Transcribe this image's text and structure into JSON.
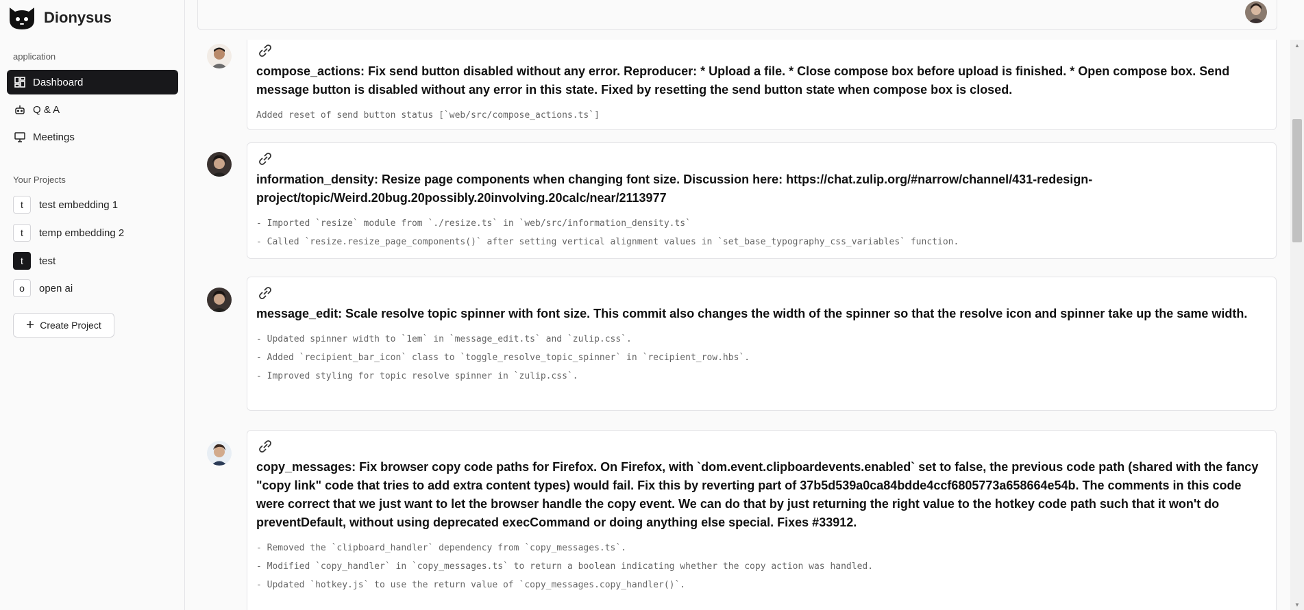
{
  "app": {
    "name": "Dionysus"
  },
  "sidebar": {
    "section_application": "application",
    "nav": [
      {
        "label": "Dashboard",
        "icon": "dashboard-icon",
        "active": true
      },
      {
        "label": "Q & A",
        "icon": "bot-icon",
        "active": false
      },
      {
        "label": "Meetings",
        "icon": "presentation-icon",
        "active": false
      }
    ],
    "section_projects": "Your Projects",
    "projects": [
      {
        "badge": "t",
        "label": "test embedding 1",
        "selected": false
      },
      {
        "badge": "t",
        "label": "temp embedding 2",
        "selected": false
      },
      {
        "badge": "t",
        "label": "test",
        "selected": true
      },
      {
        "badge": "o",
        "label": "open ai",
        "selected": false
      }
    ],
    "create_project_label": "Create Project"
  },
  "colors": {
    "active_nav_bg": "#18181b",
    "card_border": "#e4e4e7"
  },
  "commits": [
    {
      "title": "compose_actions: Fix send button disabled without any error. Reproducer: * Upload a file. * Close compose box before upload is finished. * Open compose box. Send message button is disabled without any error in this state. Fixed by resetting the send button state when compose box is closed.",
      "notes": [
        "Added reset of send button status [`web/src/compose_actions.ts`]"
      ]
    },
    {
      "title": "information_density: Resize page components when changing font size. Discussion here: https://chat.zulip.org/#narrow/channel/431-redesign-project/topic/Weird.20bug.20possibly.20involving.20calc/near/2113977",
      "notes": [
        "- Imported `resize` module from `./resize.ts` in `web/src/information_density.ts`",
        "- Called `resize.resize_page_components()` after setting vertical alignment values in `set_base_typography_css_variables` function."
      ]
    },
    {
      "title": "message_edit: Scale resolve topic spinner with font size. This commit also changes the width of the spinner so that the resolve icon and spinner take up the same width.",
      "notes": [
        "- Updated spinner width to `1em` in `message_edit.ts` and `zulip.css`.",
        "- Added `recipient_bar_icon` class to `toggle_resolve_topic_spinner` in `recipient_row.hbs`.",
        "- Improved styling for topic resolve spinner in `zulip.css`."
      ]
    },
    {
      "title": "copy_messages: Fix browser copy code paths for Firefox. On Firefox, with `dom.event.clipboardevents.enabled` set to false, the previous code path (shared with the fancy \"copy link\" code that tries to add extra content types) would fail. Fix this by reverting part of 37b5d539a0ca84bdde4ccf6805773a658664e54b. The comments in this code were correct that we just want to let the browser handle the copy event. We can do that by just returning the right value to the hotkey code path such that it won't do preventDefault, without using deprecated execCommand or doing anything else special. Fixes #33912.",
      "notes": [
        "- Removed the `clipboard_handler` dependency from `copy_messages.ts`.",
        "- Modified `copy_handler` in `copy_messages.ts` to return a boolean indicating whether the copy action was handled.",
        "- Updated `hotkey.js` to use the return value of `copy_messages.copy_handler()`."
      ]
    }
  ]
}
